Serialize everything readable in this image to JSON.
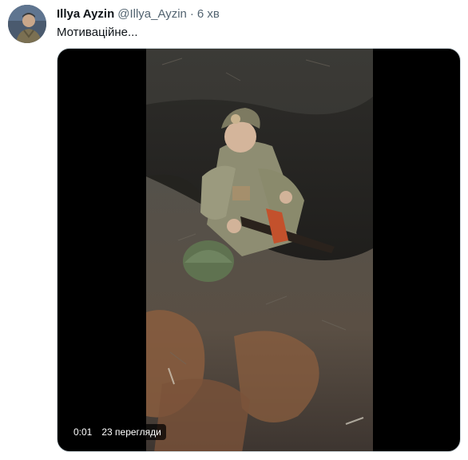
{
  "author": {
    "name": "Illya Ayzin",
    "handle": "@Illya_Ayzin",
    "separator": "·",
    "time": "6 хв"
  },
  "tweet": {
    "text": "Мотиваційне..."
  },
  "video": {
    "elapsed": "0:01",
    "views": "23 перегляди"
  },
  "colors": {
    "name": "#0f1419",
    "secondary": "#536471",
    "media_background": "#000000",
    "overlay": "rgba(0,0,0,0.72)"
  }
}
